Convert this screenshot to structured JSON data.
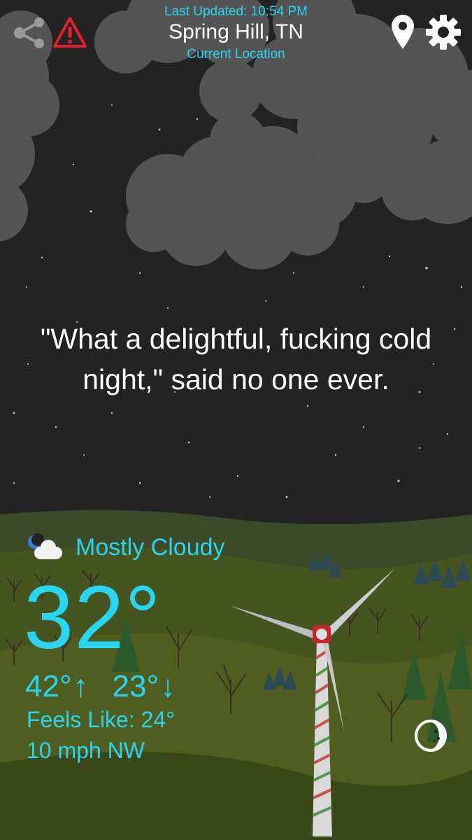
{
  "header": {
    "last_updated": "Last Updated: 10:54 PM",
    "location": "Spring Hill, TN",
    "location_sub": "Current Location"
  },
  "toolbar": {
    "share_icon": "share-icon",
    "alert_icon": "warning-triangle-icon",
    "location_icon": "map-pin-icon",
    "settings_icon": "gear-icon"
  },
  "quote": "\"What a delightful, fucking cold night,\" said no one ever.",
  "weather": {
    "condition": "Mostly Cloudy",
    "condition_icon": "moon-cloud-icon",
    "temperature": "32°",
    "high": "42°",
    "high_arrow": "↑",
    "low": "23°",
    "low_arrow": "↓",
    "feels_like": "Feels Like: 24°",
    "wind": "10 mph NW"
  },
  "moon_phase_icon": "moon-phase-icon",
  "colors": {
    "accent": "#27d6f2",
    "sky": "#232324",
    "cloud": "#5a5a5a",
    "hill_far": "#3e4a26",
    "hill_near": "#4a5a22",
    "alert_red": "#e0202a"
  }
}
